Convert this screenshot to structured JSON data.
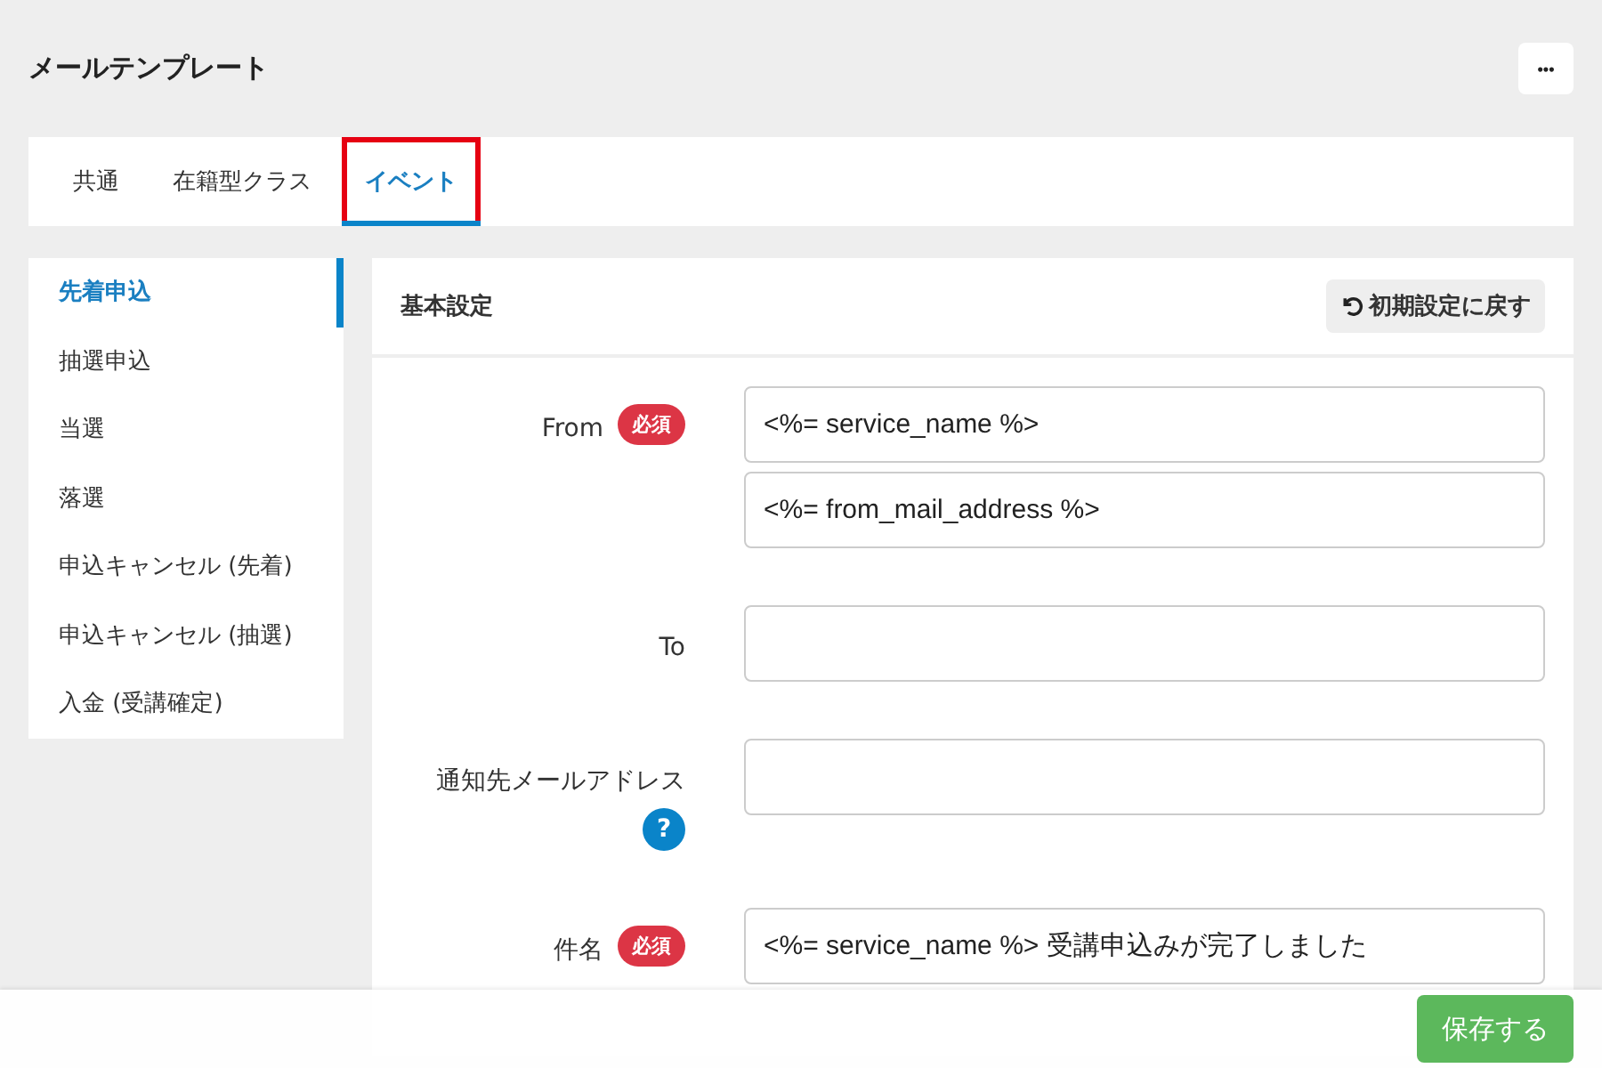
{
  "page": {
    "title": "メールテンプレート",
    "more_button": "•••"
  },
  "tabs": [
    {
      "label": "共通",
      "selected": false,
      "highlighted": false
    },
    {
      "label": "在籍型クラス",
      "selected": false,
      "highlighted": false
    },
    {
      "label": "イベント",
      "selected": true,
      "highlighted": true
    }
  ],
  "sidebar": {
    "items": [
      {
        "label": "先着申込",
        "selected": true
      },
      {
        "label": "抽選申込",
        "selected": false
      },
      {
        "label": "当選",
        "selected": false
      },
      {
        "label": "落選",
        "selected": false
      },
      {
        "label": "申込キャンセル (先着)",
        "selected": false
      },
      {
        "label": "申込キャンセル (抽選)",
        "selected": false
      },
      {
        "label": "入金 (受講確定)",
        "selected": false
      }
    ]
  },
  "panel": {
    "title": "基本設定",
    "reset_button": "初期設定に戻す",
    "fields": [
      {
        "label": "From",
        "required_badge": "必須",
        "values": [
          "<%= service_name %>",
          "<%= from_mail_address %>"
        ]
      },
      {
        "label": "To"
      },
      {
        "label": "通知先メールアドレス",
        "help_icon": "?"
      },
      {
        "label": "件名",
        "required_badge": "必須",
        "values": [
          "<%= service_name %> 受講申込みが完了しました"
        ]
      }
    ]
  },
  "footer": {
    "save_button": "保存する"
  }
}
